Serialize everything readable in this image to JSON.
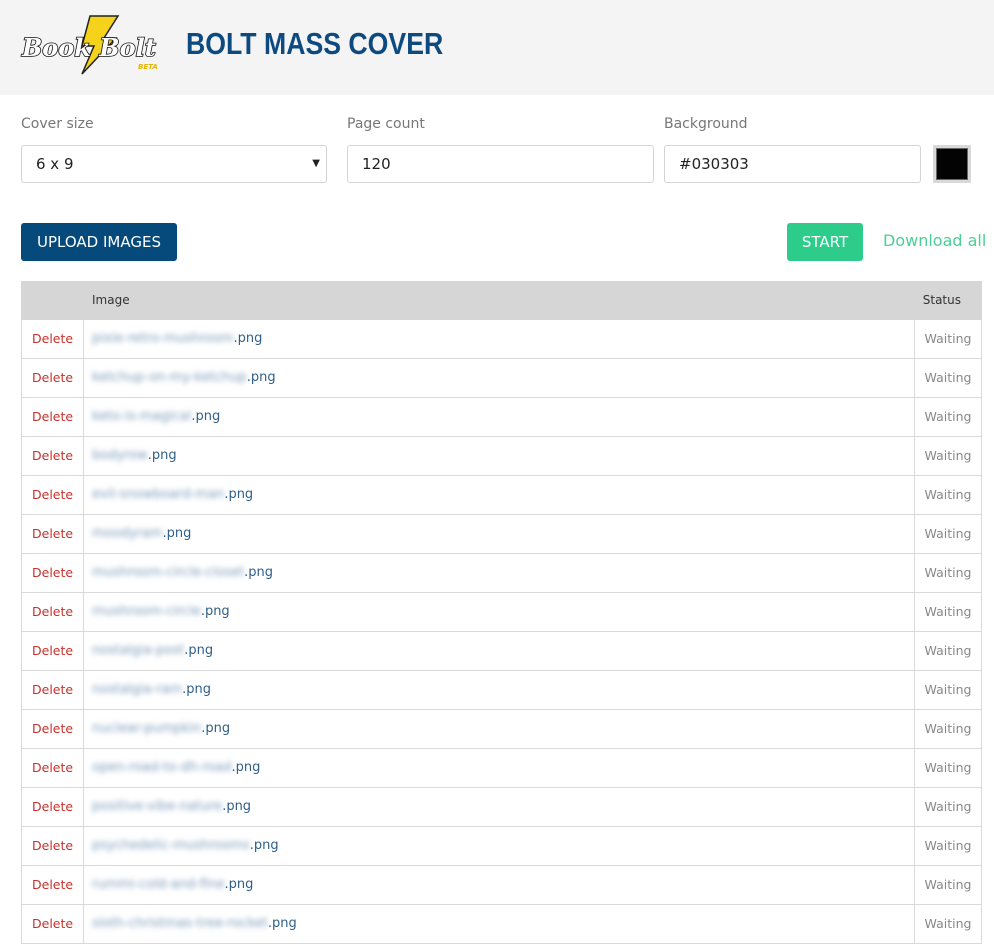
{
  "header": {
    "logo_text": "Book Bolt",
    "logo_badge": "BETA",
    "title": "BOLT MASS COVER"
  },
  "form": {
    "cover_size": {
      "label": "Cover size",
      "value": "6 x 9"
    },
    "page_count": {
      "label": "Page count",
      "value": "120"
    },
    "background": {
      "label": "Background",
      "value": "#030303",
      "swatch_color": "#030303"
    }
  },
  "actions": {
    "upload_label": "UPLOAD IMAGES",
    "start_label": "START",
    "download_all_label": "Download all"
  },
  "colors": {
    "brand_blue": "#0d4a80",
    "upload_button": "#054a7a",
    "start_button": "#2ecc8b",
    "download_link": "#4ccf96",
    "delete_link": "#c9302c"
  },
  "table": {
    "columns": [
      "",
      "Image",
      "Status"
    ],
    "rows": [
      {
        "action": "Delete",
        "name_redacted": "pixie-retro-mushroom",
        "ext": ".png",
        "status": "Waiting"
      },
      {
        "action": "Delete",
        "name_redacted": "ketchup-on-my-ketchup",
        "ext": ".png",
        "status": "Waiting"
      },
      {
        "action": "Delete",
        "name_redacted": "keto-is-magical",
        "ext": ".png",
        "status": "Waiting"
      },
      {
        "action": "Delete",
        "name_redacted": "bodyrow",
        "ext": ".png",
        "status": "Waiting"
      },
      {
        "action": "Delete",
        "name_redacted": "evil-snowboard-man",
        "ext": ".png",
        "status": "Waiting"
      },
      {
        "action": "Delete",
        "name_redacted": "moodyram",
        "ext": ".png",
        "status": "Waiting"
      },
      {
        "action": "Delete",
        "name_redacted": "mushroom-circle-closet",
        "ext": ".png",
        "status": "Waiting"
      },
      {
        "action": "Delete",
        "name_redacted": "mushroom-circle",
        "ext": ".png",
        "status": "Waiting"
      },
      {
        "action": "Delete",
        "name_redacted": "nostalgia-post",
        "ext": ".png",
        "status": "Waiting"
      },
      {
        "action": "Delete",
        "name_redacted": "nostalgia-ram",
        "ext": ".png",
        "status": "Waiting"
      },
      {
        "action": "Delete",
        "name_redacted": "nuclear-pumpkin",
        "ext": ".png",
        "status": "Waiting"
      },
      {
        "action": "Delete",
        "name_redacted": "open-road-to-dh-road",
        "ext": ".png",
        "status": "Waiting"
      },
      {
        "action": "Delete",
        "name_redacted": "positive-vibe-nature",
        "ext": ".png",
        "status": "Waiting"
      },
      {
        "action": "Delete",
        "name_redacted": "psychedelic-mushrooms",
        "ext": ".png",
        "status": "Waiting"
      },
      {
        "action": "Delete",
        "name_redacted": "rummi-cold-and-fine",
        "ext": ".png",
        "status": "Waiting"
      },
      {
        "action": "Delete",
        "name_redacted": "sloth-christmas-tree-rocket",
        "ext": ".png",
        "status": "Waiting"
      }
    ]
  }
}
